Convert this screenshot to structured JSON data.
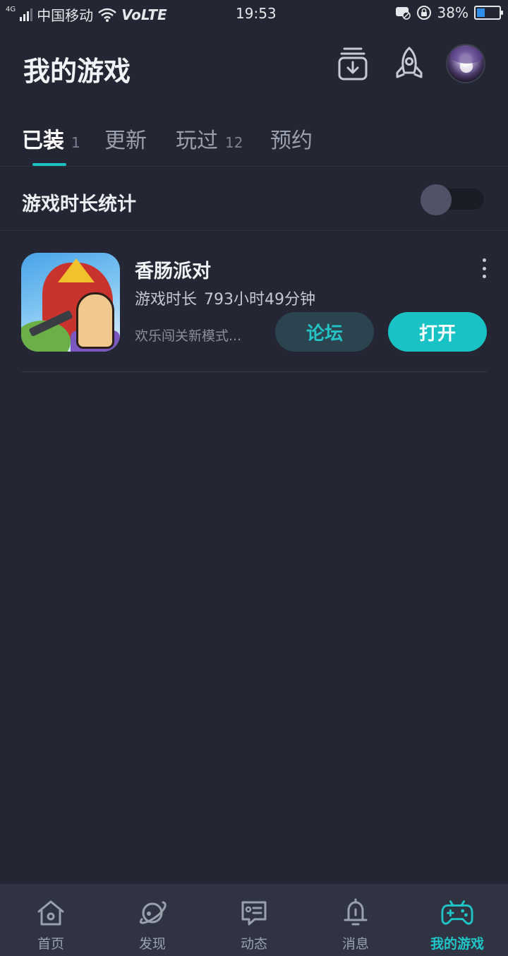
{
  "status_bar": {
    "network": "4G",
    "carrier": "中国移动",
    "volte": "VoLTE",
    "time": "19:53",
    "battery": "38%",
    "battery_level": 0.38
  },
  "header": {
    "title": "我的游戏"
  },
  "tabs": [
    {
      "label": "已装",
      "count": "1",
      "active": true
    },
    {
      "label": "更新",
      "count": ""
    },
    {
      "label": "玩过",
      "count": "12"
    },
    {
      "label": "预约",
      "count": ""
    }
  ],
  "stats": {
    "label": "游戏时长统计",
    "enabled": false
  },
  "game": {
    "name": "香肠派对",
    "play_time_label": "游戏时长",
    "play_time_value": "793小时49分钟",
    "description": "欢乐闯关新模式...",
    "forum_button": "论坛",
    "open_button": "打开"
  },
  "bottom_nav": [
    {
      "label": "首页",
      "icon": "home-icon"
    },
    {
      "label": "发现",
      "icon": "planet-icon"
    },
    {
      "label": "动态",
      "icon": "feed-icon"
    },
    {
      "label": "消息",
      "icon": "bell-icon"
    },
    {
      "label": "我的游戏",
      "icon": "gamepad-icon",
      "active": true
    }
  ],
  "colors": {
    "background": "#242733",
    "accent": "#19c2c4",
    "nav_background": "#303442"
  }
}
